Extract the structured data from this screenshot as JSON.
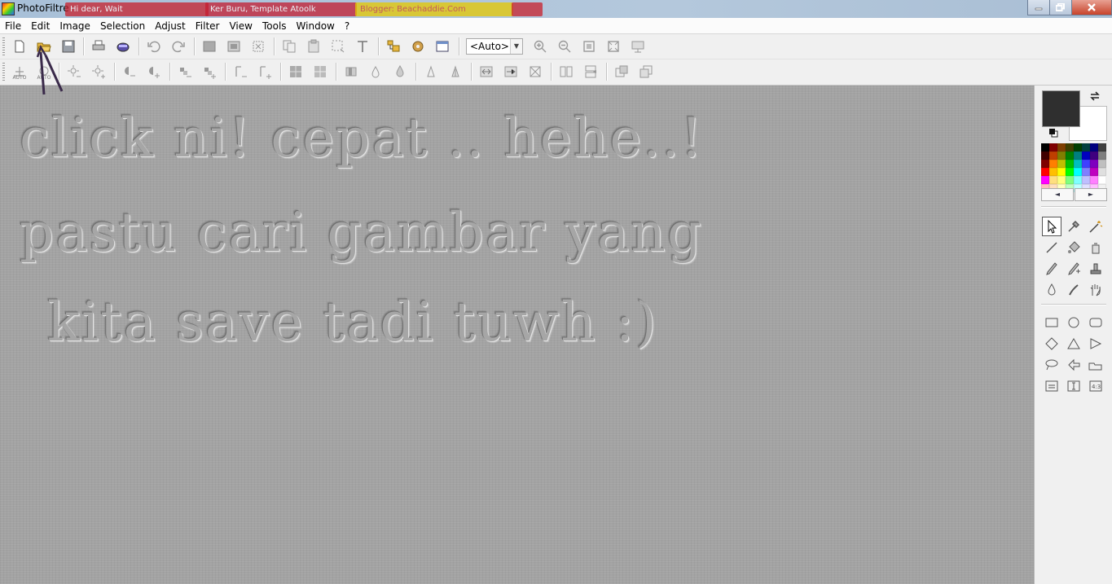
{
  "window": {
    "title": "PhotoFiltre",
    "background_tabs": [
      "Hi dear, Wait",
      "Ker Buru, Template Atoolk",
      "Blogger: Beachaddie.Com",
      ""
    ]
  },
  "menu": [
    "File",
    "Edit",
    "Image",
    "Selection",
    "Adjust",
    "Filter",
    "View",
    "Tools",
    "Window",
    "?"
  ],
  "toolbar": {
    "zoom_value": "<Auto>",
    "auto_label": "AUTO"
  },
  "canvas": {
    "lines": [
      "click ni! cepat .. hehe..!",
      "pastu cari gambar yang",
      "kita save tadi tuwh :)"
    ]
  },
  "colors": {
    "foreground": "#2f2f2f",
    "background": "#ffffff",
    "workspace": "#a3a3a3"
  },
  "palette": [
    "#000000",
    "#7f0000",
    "#7f3f00",
    "#3f3f00",
    "#003f00",
    "#003f3f",
    "#00007f",
    "#3f3f3f",
    "#3f0000",
    "#bf3f00",
    "#7f7f00",
    "#007f00",
    "#007f7f",
    "#0000bf",
    "#3f007f",
    "#7f7f7f",
    "#7f0000",
    "#ff7f00",
    "#bfbf00",
    "#00bf00",
    "#00bfbf",
    "#3f3fff",
    "#7f00bf",
    "#bfbfbf",
    "#ff0000",
    "#ffbf00",
    "#ffff00",
    "#00ff00",
    "#00ffff",
    "#7f7fff",
    "#bf00bf",
    "#dfdfdf",
    "#ff00ff",
    "#ffdf7f",
    "#ffff7f",
    "#7fff7f",
    "#7fffff",
    "#bfbfff",
    "#ff7fff",
    "#ffffff",
    "#ffbfbf",
    "#ffdfbf",
    "#ffffbf",
    "#bfffbf",
    "#bfffff",
    "#dfdfff",
    "#ffbfff",
    "#f0f0f0"
  ]
}
